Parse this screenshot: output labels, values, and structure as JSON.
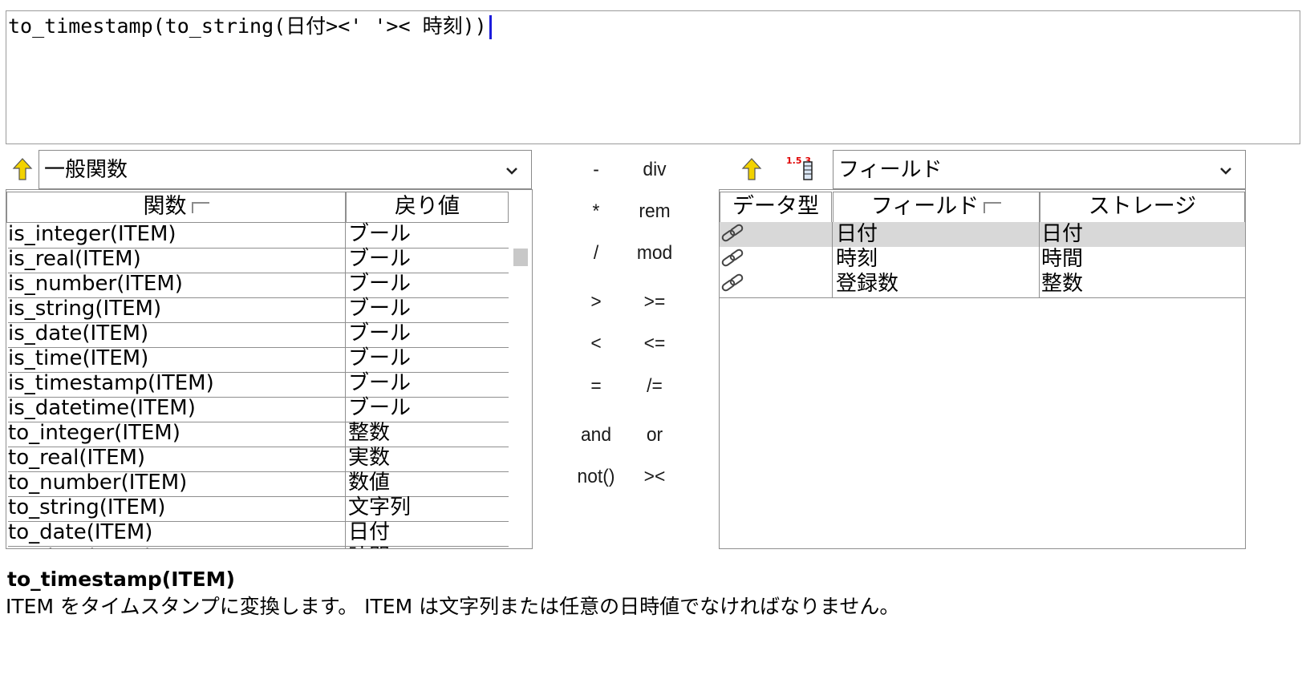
{
  "expression": {
    "text": "to_timestamp(to_string(日付><' '>< 時刻))"
  },
  "functions_panel": {
    "category_selected": "一般関数",
    "columns": [
      "関数",
      "戻り値"
    ],
    "rows": [
      {
        "func": "is_integer(ITEM)",
        "ret": "ブール"
      },
      {
        "func": "is_real(ITEM)",
        "ret": "ブール"
      },
      {
        "func": "is_number(ITEM)",
        "ret": "ブール"
      },
      {
        "func": "is_string(ITEM)",
        "ret": "ブール"
      },
      {
        "func": "is_date(ITEM)",
        "ret": "ブール"
      },
      {
        "func": "is_time(ITEM)",
        "ret": "ブール"
      },
      {
        "func": "is_timestamp(ITEM)",
        "ret": "ブール"
      },
      {
        "func": "is_datetime(ITEM)",
        "ret": "ブール"
      },
      {
        "func": "to_integer(ITEM)",
        "ret": "整数"
      },
      {
        "func": "to_real(ITEM)",
        "ret": "実数"
      },
      {
        "func": "to_number(ITEM)",
        "ret": "数値"
      },
      {
        "func": "to_string(ITEM)",
        "ret": "文字列"
      },
      {
        "func": "to_date(ITEM)",
        "ret": "日付"
      },
      {
        "func": "to_time(ITEM)",
        "ret": "時間"
      }
    ],
    "scroll_position": 0.08
  },
  "operators": [
    [
      "-",
      "div"
    ],
    [
      "*",
      "rem"
    ],
    [
      "/",
      "mod"
    ],
    [
      ">",
      ">="
    ],
    [
      "<",
      "<="
    ],
    [
      "=",
      "/="
    ],
    [
      "and",
      "or"
    ],
    [
      "not()",
      "><"
    ]
  ],
  "fields_panel": {
    "category_selected": "フィールド",
    "columns": [
      "データ型",
      "フィールド",
      "ストレージ"
    ],
    "rows": [
      {
        "icon": "link-icon",
        "field": "日付",
        "storage": "日付",
        "selected": true
      },
      {
        "icon": "link-icon",
        "field": "時刻",
        "storage": "時間",
        "selected": false
      },
      {
        "icon": "link-icon",
        "field": "登録数",
        "storage": "整数",
        "selected": false
      }
    ],
    "icon_badge": "1.5 3"
  },
  "description": {
    "title": "to_timestamp(ITEM)",
    "body": "ITEM をタイムスタンプに変換します。 ITEM は文字列または任意の日時値でなければなりません。"
  },
  "colors": {
    "caret": "#1c1cdc",
    "selected_row": "#d8d8d8",
    "arrow_icon": "#f2d200",
    "border": "#8f8f8f"
  }
}
